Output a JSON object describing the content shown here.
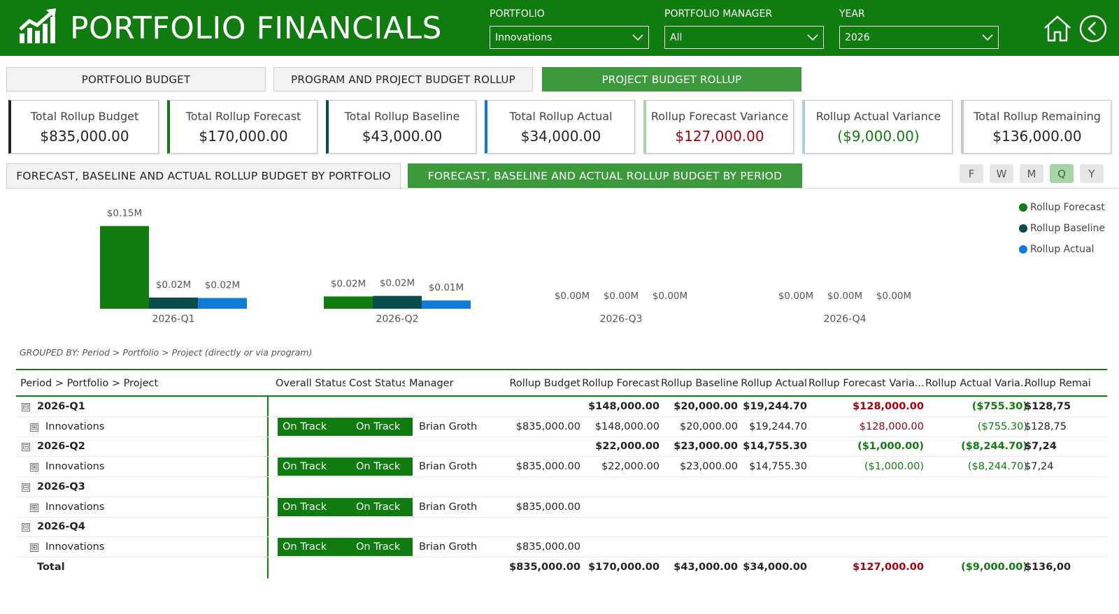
{
  "header": {
    "title": "PORTFOLIO FINANCIALS",
    "logo_icon": "chart-growth-icon",
    "filters": [
      {
        "label": "PORTFOLIO",
        "value": "Innovations"
      },
      {
        "label": "PORTFOLIO MANAGER",
        "value": "All"
      },
      {
        "label": "YEAR",
        "value": "2026"
      }
    ]
  },
  "tabs": [
    {
      "label": "PORTFOLIO BUDGET"
    },
    {
      "label": "PROGRAM AND PROJECT BUDGET ROLLUP"
    },
    {
      "label": "PROJECT BUDGET ROLLUP"
    }
  ],
  "kpis": [
    {
      "label": "Total Rollup Budget",
      "value": "$835,000.00",
      "accent": "#252423",
      "value_color": "#252423"
    },
    {
      "label": "Total Rollup Forecast",
      "value": "$170,000.00",
      "accent": "#107c10",
      "value_color": "#252423"
    },
    {
      "label": "Total Rollup Baseline",
      "value": "$43,000.00",
      "accent": "#0a4b4b",
      "value_color": "#252423"
    },
    {
      "label": "Total Rollup Actual",
      "value": "$34,000.00",
      "accent": "#0f7cd9",
      "value_color": "#252423"
    },
    {
      "label": "Rollup Forecast Variance",
      "value": "$127,000.00",
      "accent": "#a6d6a6",
      "value_color": "#a4000f"
    },
    {
      "label": "Rollup Actual Variance",
      "value": "($9,000.00)",
      "accent": "#a9cdf0",
      "value_color": "#107c10"
    },
    {
      "label": "Total Rollup Remaining",
      "value": "$136,000.00",
      "accent": "#c8c8c8",
      "value_color": "#252423"
    }
  ],
  "section_tabs": [
    {
      "label": "FORECAST, BASELINE AND ACTUAL ROLLUP BUDGET BY PORTFOLIO"
    },
    {
      "label": "FORECAST, BASELINE AND ACTUAL ROLLUP BUDGET BY PERIOD"
    }
  ],
  "period_buttons": [
    "F",
    "W",
    "M",
    "Q",
    "Y"
  ],
  "chart_data": {
    "type": "bar",
    "categories": [
      "2026-Q1",
      "2026-Q2",
      "2026-Q3",
      "2026-Q4"
    ],
    "series": [
      {
        "name": "Rollup Forecast",
        "color": "#107c10",
        "values": [
          148000,
          22000,
          0,
          0
        ],
        "labels": [
          "$0.15M",
          "$0.02M",
          "$0.00M",
          "$0.00M"
        ]
      },
      {
        "name": "Rollup Baseline",
        "color": "#0a4b4b",
        "values": [
          20000,
          23000,
          0,
          0
        ],
        "labels": [
          "$0.02M",
          "$0.02M",
          "$0.00M",
          "$0.00M"
        ]
      },
      {
        "name": "Rollup Actual",
        "color": "#0f7cd9",
        "values": [
          19244.7,
          14755.3,
          0,
          0
        ],
        "labels": [
          "$0.02M",
          "$0.01M",
          "$0.00M",
          "$0.00M"
        ]
      }
    ],
    "legend_position": "top-right",
    "ylim": [
      0,
      150000
    ]
  },
  "grouped_note": "GROUPED BY: Period > Portfolio > Project (directly or via program)",
  "table": {
    "columns": [
      "Period > Portfolio > Project",
      "Overall Status",
      "Cost Status",
      "Manager",
      "Rollup Budget",
      "Rollup Forecast",
      "Rollup Baseline",
      "Rollup Actual",
      "Rollup Forecast Varia...",
      "Rollup Actual Varia...",
      "Rollup Remai"
    ],
    "rows": [
      {
        "type": "group",
        "expander": "⊟",
        "name": "2026-Q1",
        "budget": "",
        "forecast": "$148,000.00",
        "baseline": "$20,000.00",
        "actual": "$19,244.70",
        "fvar": "$128,000.00",
        "fvar_color": "red",
        "avar": "($755.30)",
        "avar_color": "green",
        "remaining": "$128,75"
      },
      {
        "type": "item",
        "expander": "⊞",
        "name": "Innovations",
        "overall": "On Track",
        "cost": "On Track",
        "manager": "Brian Groth",
        "budget": "$835,000.00",
        "forecast": "$148,000.00",
        "baseline": "$20,000.00",
        "actual": "$19,244.70",
        "fvar": "$128,000.00",
        "fvar_color": "red",
        "avar": "($755.30)",
        "avar_color": "green",
        "remaining": "$128,75"
      },
      {
        "type": "group",
        "expander": "⊟",
        "name": "2026-Q2",
        "budget": "",
        "forecast": "$22,000.00",
        "baseline": "$23,000.00",
        "actual": "$14,755.30",
        "fvar": "($1,000.00)",
        "fvar_color": "green",
        "avar": "($8,244.70)",
        "avar_color": "green",
        "remaining": "$7,24"
      },
      {
        "type": "item",
        "expander": "⊞",
        "name": "Innovations",
        "overall": "On Track",
        "cost": "On Track",
        "manager": "Brian Groth",
        "budget": "$835,000.00",
        "forecast": "$22,000.00",
        "baseline": "$23,000.00",
        "actual": "$14,755.30",
        "fvar": "($1,000.00)",
        "fvar_color": "green",
        "avar": "($8,244.70)",
        "avar_color": "green",
        "remaining": "$7,24"
      },
      {
        "type": "group",
        "expander": "⊟",
        "name": "2026-Q3",
        "budget": "",
        "forecast": "",
        "baseline": "",
        "actual": "",
        "fvar": "",
        "fvar_color": "red",
        "avar": "",
        "avar_color": "green",
        "remaining": ""
      },
      {
        "type": "item",
        "expander": "⊞",
        "name": "Innovations",
        "overall": "On Track",
        "cost": "On Track",
        "manager": "Brian Groth",
        "budget": "$835,000.00",
        "forecast": "",
        "baseline": "",
        "actual": "",
        "fvar": "",
        "fvar_color": "red",
        "avar": "",
        "avar_color": "green",
        "remaining": ""
      },
      {
        "type": "group",
        "expander": "⊟",
        "name": "2026-Q4",
        "budget": "",
        "forecast": "",
        "baseline": "",
        "actual": "",
        "fvar": "",
        "fvar_color": "red",
        "avar": "",
        "avar_color": "green",
        "remaining": ""
      },
      {
        "type": "item",
        "expander": "⊞",
        "name": "Innovations",
        "overall": "On Track",
        "cost": "On Track",
        "manager": "Brian Groth",
        "budget": "$835,000.00",
        "forecast": "",
        "baseline": "",
        "actual": "",
        "fvar": "",
        "fvar_color": "red",
        "avar": "",
        "avar_color": "green",
        "remaining": ""
      }
    ],
    "total": {
      "name": "Total",
      "budget": "$835,000.00",
      "forecast": "$170,000.00",
      "baseline": "$43,000.00",
      "actual": "$34,000.00",
      "fvar": "$127,000.00",
      "fvar_color": "red",
      "avar": "($9,000.00)",
      "avar_color": "green",
      "remaining": "$136,00"
    }
  }
}
